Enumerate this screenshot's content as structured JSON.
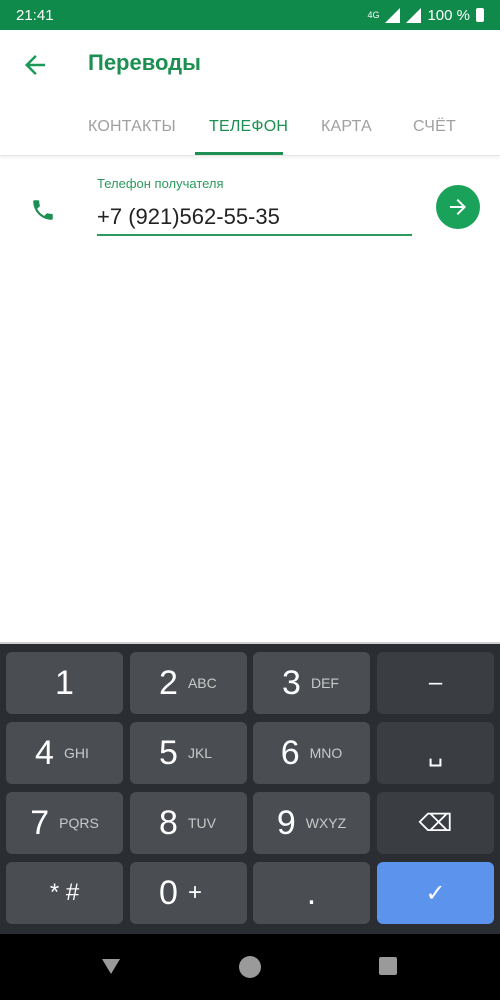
{
  "status_bar": {
    "time": "21:41",
    "network": "4G",
    "battery": "100 %"
  },
  "app_bar": {
    "title": "Переводы",
    "back_icon": "arrow-left-icon"
  },
  "tabs": [
    {
      "label": "КОНТАКТЫ",
      "active": false
    },
    {
      "label": "ТЕЛЕФОН",
      "active": true
    },
    {
      "label": "КАРТА",
      "active": false
    },
    {
      "label": "СЧЁТ",
      "active": false
    }
  ],
  "form": {
    "label": "Телефон получателя",
    "value": "+7 (921)562-55-35",
    "phone_icon": "phone-icon",
    "submit_icon": "arrow-right-icon"
  },
  "keyboard": {
    "rows": [
      [
        {
          "num": "1",
          "sub": ""
        },
        {
          "num": "2",
          "sub": "ABC"
        },
        {
          "num": "3",
          "sub": "DEF"
        },
        {
          "num": "–",
          "sub": "",
          "fn": true
        }
      ],
      [
        {
          "num": "4",
          "sub": "GHI"
        },
        {
          "num": "5",
          "sub": "JKL"
        },
        {
          "num": "6",
          "sub": "MNO"
        },
        {
          "num": "␣",
          "sub": "",
          "fn": true
        }
      ],
      [
        {
          "num": "7",
          "sub": "PQRS"
        },
        {
          "num": "8",
          "sub": "TUV"
        },
        {
          "num": "9",
          "sub": "WXYZ"
        },
        {
          "num": "⌫",
          "sub": "",
          "fn": true
        }
      ],
      [
        {
          "num": "* #",
          "sub": ""
        },
        {
          "num": "0",
          "sub": "+"
        },
        {
          "num": ".",
          "sub": ""
        },
        {
          "num": "✓",
          "sub": "",
          "enter": true
        }
      ]
    ]
  },
  "colors": {
    "brand": "#1d8f52",
    "status_bar": "#0f8a4a",
    "enter_key": "#5c93ec"
  }
}
